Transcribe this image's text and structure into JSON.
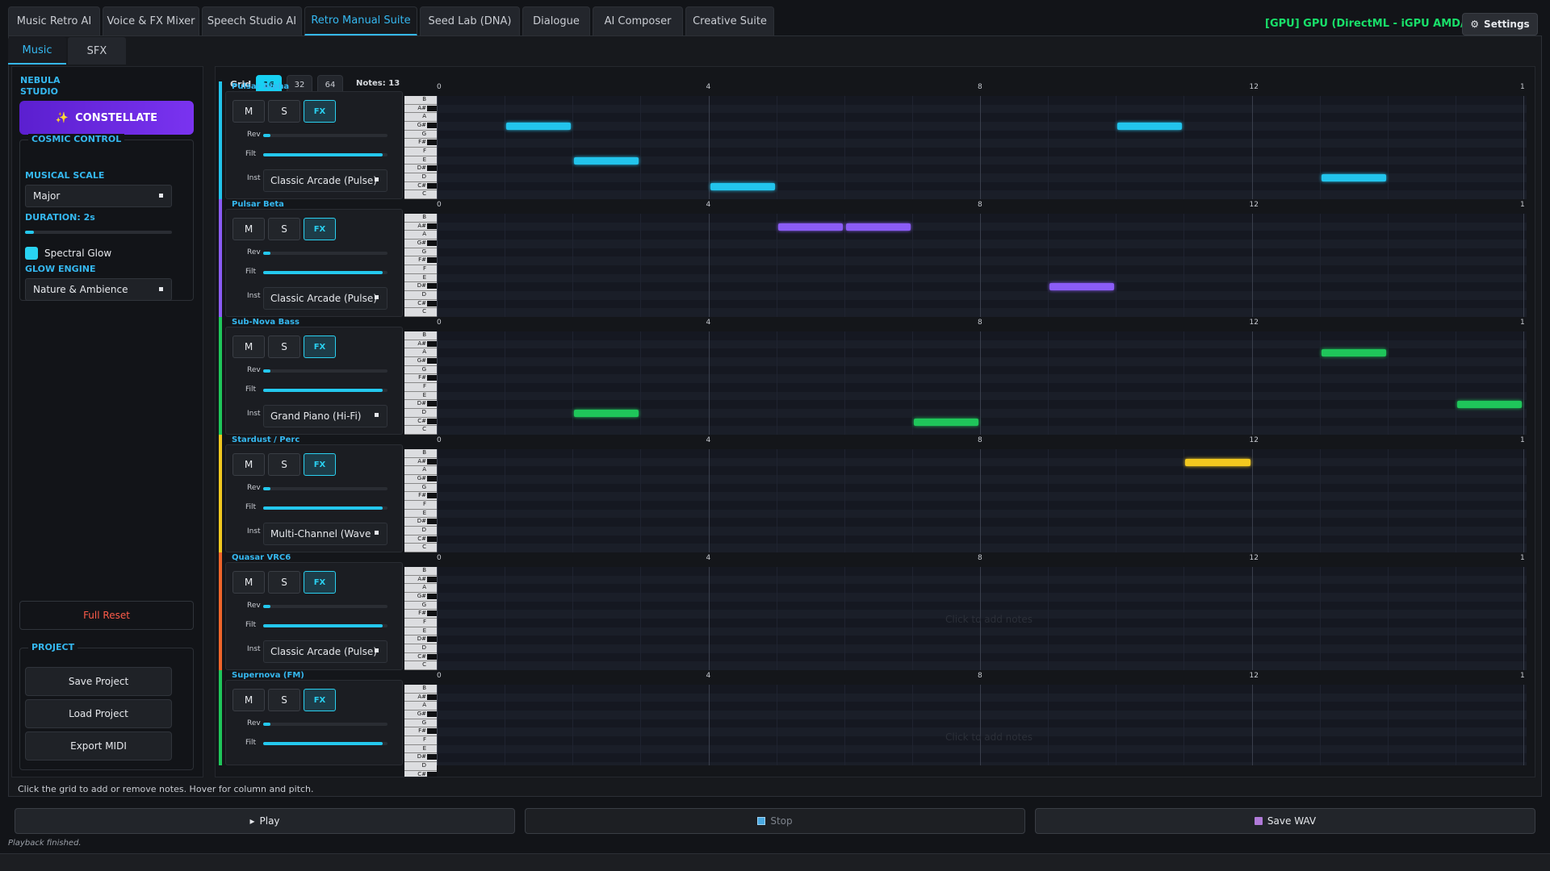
{
  "top_tabs": [
    "Music Retro AI",
    "Voice & FX Mixer",
    "Speech Studio AI",
    "Retro Manual Suite",
    "Seed Lab (DNA)",
    "Dialogue",
    "AI Composer",
    "Creative Suite"
  ],
  "active_top_tab": "Retro Manual Suite",
  "gpu_label": "[GPU] GPU (DirectML - iGPU AMD/Intel)",
  "settings_label": "Settings",
  "sub_tabs": [
    "Music",
    "SFX"
  ],
  "sidebar": {
    "brand": "NEBULA STUDIO",
    "constellate_label": "CONSTELLATE",
    "cosmic_control_title": "COSMIC CONTROL",
    "musical_scale_label": "MUSICAL SCALE",
    "musical_scale_value": "Major",
    "duration_label": "DURATION: 2s",
    "duration_fraction": 0.06,
    "spectral_glow_label": "Spectral Glow",
    "spectral_glow_checked": true,
    "glow_engine_label": "GLOW ENGINE",
    "glow_engine_value": "Nature & Ambience",
    "full_reset_label": "Full Reset",
    "project_title": "PROJECT",
    "save_project": "Save Project",
    "load_project": "Load Project",
    "export_midi": "Export MIDI"
  },
  "grid_bar": {
    "label": "Grid",
    "options": [
      "16",
      "32",
      "64"
    ],
    "selected": "16",
    "notes_count": "Notes: 13"
  },
  "pitch_labels": [
    "B",
    "A#",
    "A",
    "G#",
    "G",
    "F#",
    "F",
    "E",
    "D#",
    "D",
    "C#",
    "C"
  ],
  "ruler_labels": [
    "0",
    "4",
    "8",
    "12",
    "1"
  ],
  "steps": 16,
  "hint_text": "Click to add notes",
  "track_controls": {
    "mute": "M",
    "solo": "S",
    "fx": "FX",
    "rev": "Rev",
    "filt": "Filt",
    "inst": "Inst"
  },
  "tracks": [
    {
      "name": "Pulsar Alpha",
      "color": "#22c4ec",
      "instrument": "Classic Arcade (Pulse)",
      "rev": 0.06,
      "filt": 0.96,
      "notes": [
        {
          "step": 1,
          "len": 1,
          "pitch": "G#"
        },
        {
          "step": 2,
          "len": 1,
          "pitch": "E"
        },
        {
          "step": 4,
          "len": 1,
          "pitch": "C#"
        },
        {
          "step": 10,
          "len": 1,
          "pitch": "G#"
        },
        {
          "step": 13,
          "len": 1,
          "pitch": "D"
        }
      ]
    },
    {
      "name": "Pulsar Beta",
      "color": "#8b5cf6",
      "instrument": "Classic Arcade (Pulse)",
      "rev": 0.06,
      "filt": 0.96,
      "notes": [
        {
          "step": 5,
          "len": 1,
          "pitch": "A#"
        },
        {
          "step": 6,
          "len": 1,
          "pitch": "A#"
        },
        {
          "step": 9,
          "len": 1,
          "pitch": "D#"
        }
      ]
    },
    {
      "name": "Sub-Nova Bass",
      "color": "#1fc65a",
      "instrument": "Grand Piano (Hi-Fi)",
      "rev": 0.06,
      "filt": 0.96,
      "notes": [
        {
          "step": 2,
          "len": 1,
          "pitch": "D"
        },
        {
          "step": 7,
          "len": 1,
          "pitch": "C#"
        },
        {
          "step": 13,
          "len": 1,
          "pitch": "A"
        },
        {
          "step": 15,
          "len": 1,
          "pitch": "D#"
        }
      ]
    },
    {
      "name": "Stardust / Perc",
      "color": "#f2c81f",
      "instrument": "Multi-Channel (Wave",
      "rev": 0.06,
      "filt": 0.96,
      "notes": [
        {
          "step": 11,
          "len": 1,
          "pitch": "A#"
        }
      ]
    },
    {
      "name": "Quasar VRC6",
      "color": "#f0652a",
      "instrument": "Classic Arcade (Pulse)",
      "rev": 0.06,
      "filt": 0.96,
      "notes": []
    },
    {
      "name": "Supernova (FM)",
      "color": "#1fc65a",
      "instrument": "",
      "rev": 0.06,
      "filt": 0.96,
      "notes": []
    }
  ],
  "status_text": "Click the grid to add or remove notes. Hover for column and pitch.",
  "play_label": "Play",
  "stop_label": "Stop",
  "save_wav_label": "Save WAV",
  "playback_status": "Playback finished."
}
